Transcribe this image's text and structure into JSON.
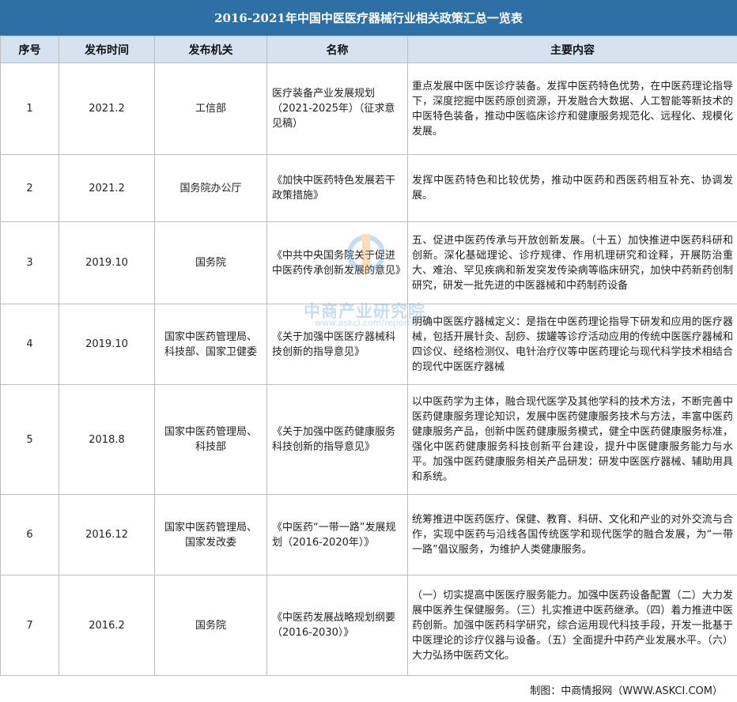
{
  "title": "2016-2021年中国中医医疗器械行业相关政策汇总一览表",
  "headers": [
    "序号",
    "发布时间",
    "发布机关",
    "名称",
    "主要内容"
  ],
  "rows": [
    {
      "no": "1",
      "date": "2021.2",
      "org": "工信部",
      "name": "医疗装备产业发展规划（2021-2025年）（征求意见稿）",
      "content": "重点发展中医中医诊疗装备。发挥中医药特色优势，在中医药理论指导下，深度挖掘中医药原创资源，开发融合大数据、人工智能等新技术的中医特色装备，推动中医临床诊疗和健康服务规范化、远程化、规模化发展。"
    },
    {
      "no": "2",
      "date": "2021.2",
      "org": "国务院办公厅",
      "name": "《加快中医药特色发展若干政策措施》",
      "content": "发挥中医药特色和比较优势，推动中医药和西医药相互补充、协调发展。"
    },
    {
      "no": "3",
      "date": "2019.10",
      "org": "国务院",
      "name": "《中共中央国务院关于促进中医药传承创新发展的意见》",
      "content": "五、促进中医药传承与开放创新发展。（十五）加快推进中医药科研和创新。深化基础理论、诊疗规律、作用机理研究和诠释，开展防治重大、难治、罕见疾病和新发突发传染病等临床研究，加快中药新药创制研究，研发一批先进的中医器械和中药制药设备"
    },
    {
      "no": "4",
      "date": "2019.10",
      "org": "国家中医药管理局、科技部、国家卫健委",
      "name": "《关于加强中医医疗器械科技创新的指导意见》",
      "content": "明确中医医疗器械定义：是指在中医药理论指导下研发和应用的医疗器械，包括开展针灸、刮痧、拔罐等诊疗活动应用的传统中医医疗器械和四诊仪、经络检测仪、电针治疗仪等中医药理论与现代科学技术相结合的现代中医医疗器械"
    },
    {
      "no": "5",
      "date": "2018.8",
      "org": "国家中医药管理局、科技部",
      "name": "《关于加强中医药健康服务科技创新的指导意见》",
      "content": "以中医药学为主体，融合现代医学及其他学科的技术方法，不断完善中医药健康服务理论知识，发展中医药健康服务技术与方法，丰富中医药健康服务产品，创新中医药健康服务模式，健全中医药健康服务标准，强化中医药健康服务科技创新平台建设，提升中医健康服务能力与水平。加强中医药健康服务相关产品研发：研发中医医疗器械、辅助用具和系统。"
    },
    {
      "no": "6",
      "date": "2016.12",
      "org": "国家中医药管理局、国家发改委",
      "name": "《中医药“一带一路”发展规划（2016-2020年）》",
      "content": "统筹推进中医药医疗、保健、教育、科研、文化和产业的对外交流与合作，实现中医药与沿线各国传统医学和现代医学的融合发展，为“一带一路”倡议服务，为维护人类健康服务。"
    },
    {
      "no": "7",
      "date": "2016.2",
      "org": "国务院",
      "name": "《中医药发展战略规划纲要（2016-2030）》",
      "content": "（一）切实提高中医医疗服务能力。加强中医药设备配置（二）大力发展中医养生保健服务。（三）扎实推进中医药继承。（四）着力推进中医药创新。加强中医药科学研究，综合运用现代科技手段，开发一批基于中医理论的诊疗仪器与设备。（五）全面提升中药产业发展水平。（六）大力弘扬中医药文化。"
    }
  ],
  "footer": "制图：中商情报网（WWW.ASKCI.COM）",
  "watermark": {
    "text": "中商产业研究院",
    "url": "www.askci.com/reports"
  },
  "colors": {
    "title_bg": "#2d70a6",
    "header_bg": "#d5e3f1",
    "border": "#bdbdbd",
    "watermark": "#5aa0d8"
  }
}
